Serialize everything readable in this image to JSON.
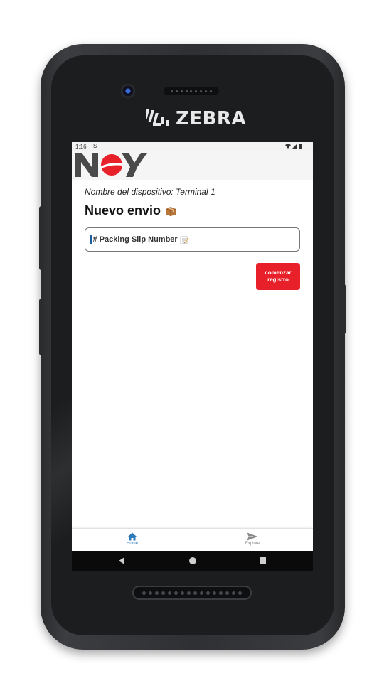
{
  "device": {
    "brand": "ZEBRA"
  },
  "status_bar": {
    "time": "1:16",
    "notification": "S"
  },
  "app": {
    "logo_text": "NOY",
    "device_name": "Nombre del dispositivo: Terminal 1",
    "title": "Nuevo envio",
    "title_icon": "package-icon",
    "slip_input": {
      "value": "# Packing Slip Number",
      "icon": "memo-icon"
    },
    "start_button": "comenzar registro"
  },
  "tabs": [
    {
      "label": "Home",
      "icon": "home-icon",
      "active": true
    },
    {
      "label": "Explore",
      "icon": "send-icon",
      "active": false
    }
  ],
  "nav": {
    "back": "back-icon",
    "home": "home-circle-icon",
    "recent": "recent-apps-icon"
  },
  "colors": {
    "accent": "#e8202a",
    "tab_active": "#2f7ab8",
    "tab_inactive": "#8a8a8a",
    "logo_red": "#e8202a",
    "logo_gray": "#4a4a4a"
  }
}
